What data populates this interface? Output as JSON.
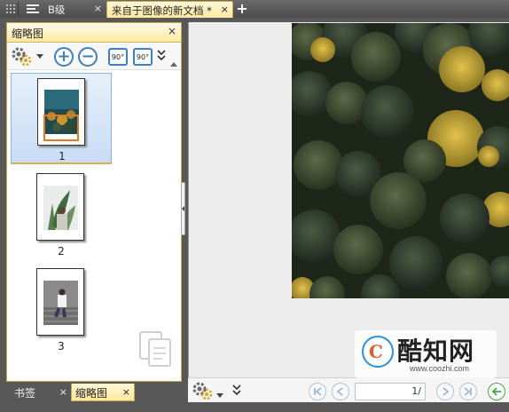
{
  "tabs": {
    "items": [
      {
        "label": "B级",
        "active": false,
        "close": "×"
      },
      {
        "label": "来自于图像的新文档 *",
        "active": true,
        "close": "×"
      }
    ],
    "new_tab": "+"
  },
  "thumbnail_pane": {
    "title": "缩略图",
    "close": "×",
    "toolbar": {
      "zoom_in": "+",
      "zoom_out": "−",
      "rotate_left": "90°",
      "rotate_right": "90°",
      "more": "»"
    },
    "thumbnails": [
      {
        "page": "1",
        "selected": true
      },
      {
        "page": "2",
        "selected": false
      },
      {
        "page": "3",
        "selected": false
      }
    ]
  },
  "bottom_tabs": [
    {
      "label": "书签",
      "close": "×",
      "active": false
    },
    {
      "label": "缩略图",
      "close": "×",
      "active": true
    }
  ],
  "nav_bar": {
    "page_value": "1/",
    "more": "»"
  },
  "watermark": {
    "logo_letter": "C",
    "brand": "酷知网",
    "site": "www.coozhi.com"
  },
  "colors": {
    "accent_blue": "#3f7fbd",
    "tab_active": "#ffe8a0",
    "selection": "#c9dcf5",
    "view_rect": "#e07b22"
  }
}
